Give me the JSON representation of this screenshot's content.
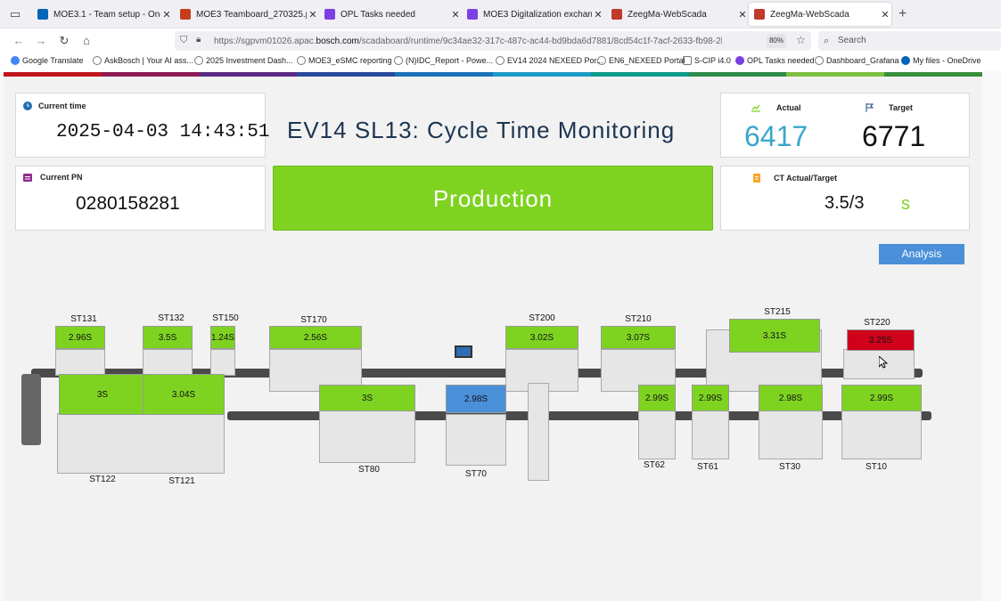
{
  "browser": {
    "tabs": [
      {
        "label": "MOE3.1 - Team setup - OneDrive",
        "icon_color": "#0364b8",
        "icon": "cloud-icon"
      },
      {
        "label": "MOE3 Teamboard_270325.pptx",
        "icon_color": "#c43e1c",
        "icon": "powerpoint-icon"
      },
      {
        "label": "OPL Tasks needed",
        "icon_color": "#7b3fe4",
        "icon": "loop-icon"
      },
      {
        "label": "MOE3 Digitalization exchanges",
        "icon_color": "#7b3fe4",
        "icon": "loop-icon"
      },
      {
        "label": "ZeegMa-WebScada",
        "icon_color": "#c0392b",
        "icon": "cube-icon"
      },
      {
        "label": "ZeegMa-WebScada",
        "icon_color": "#c0392b",
        "icon": "cube-icon"
      }
    ],
    "active_tab": 5,
    "url_prefix": "https://sgpvm01026.apac.",
    "url_host": "bosch.com",
    "url_suffix": "/scadaboard/runtime/9c34ae32-317c-487c-ac44-bd9bda6d7881/8cd54c1f-7acf-2633-fb98-2b62db9c",
    "zoom": "80%",
    "search_placeholder": "Search",
    "bookmarks": [
      "Google Translate",
      "AskBosch | Your AI ass...",
      "2025 Investment Dash...",
      "MOE3_eSMC reporting",
      "(N)IDC_Report - Powe...",
      "EV14 2024 NEXEED Por...",
      "EN6_NEXEED Portal",
      "S-CIP i4.0",
      "OPL Tasks needed",
      "Dashboard_Grafana",
      "My files - OneDrive"
    ]
  },
  "dashboard": {
    "title": "EV14 SL13: Cycle Time Monitoring",
    "current_time_label": "Current time",
    "current_time": "2025-04-03 14:43:51",
    "current_pn_label": "Current PN",
    "current_pn": "0280158281",
    "status": "Production",
    "status_color": "#7ed321",
    "actual_label": "Actual",
    "actual": "6417",
    "actual_color": "#3aa6c9",
    "target_label": "Target",
    "target": "6771",
    "ct_label": "CT Actual/Target",
    "ct_value": "3.5/3",
    "ct_unit": "s",
    "analysis_button": "Analysis"
  },
  "stations": {
    "ST131": {
      "label": "ST131",
      "value": "2.96S",
      "color": "#7ed321"
    },
    "ST132": {
      "label": "ST132",
      "value": "3.5S",
      "color": "#7ed321"
    },
    "ST150": {
      "label": "ST150",
      "value": "1.24S",
      "color": "#7ed321"
    },
    "ST170": {
      "label": "ST170",
      "value": "2.56S",
      "color": "#7ed321"
    },
    "ST200": {
      "label": "ST200",
      "value": "3.02S",
      "color": "#7ed321"
    },
    "ST210": {
      "label": "ST210",
      "value": "3.07S",
      "color": "#7ed321"
    },
    "ST215": {
      "label": "ST215",
      "value": "3.31S",
      "color": "#7ed321"
    },
    "ST220": {
      "label": "ST220",
      "value": "3.25S",
      "color": "#d0021b"
    },
    "ST122": {
      "label": "ST122",
      "value": "3S",
      "color": "#7ed321"
    },
    "ST121": {
      "label": "ST121",
      "value": "3.04S",
      "color": "#7ed321"
    },
    "ST80": {
      "label": "ST80",
      "value": "3S",
      "color": "#7ed321"
    },
    "ST70": {
      "label": "ST70",
      "value": "2.98S",
      "color": "#4a90d9"
    },
    "ST62": {
      "label": "ST62",
      "value": "2.99S",
      "color": "#7ed321"
    },
    "ST61": {
      "label": "ST61",
      "value": "2.99S",
      "color": "#7ed321"
    },
    "ST30": {
      "label": "ST30",
      "value": "2.98S",
      "color": "#7ed321"
    },
    "ST10": {
      "label": "ST10",
      "value": "2.99S",
      "color": "#7ed321"
    }
  }
}
